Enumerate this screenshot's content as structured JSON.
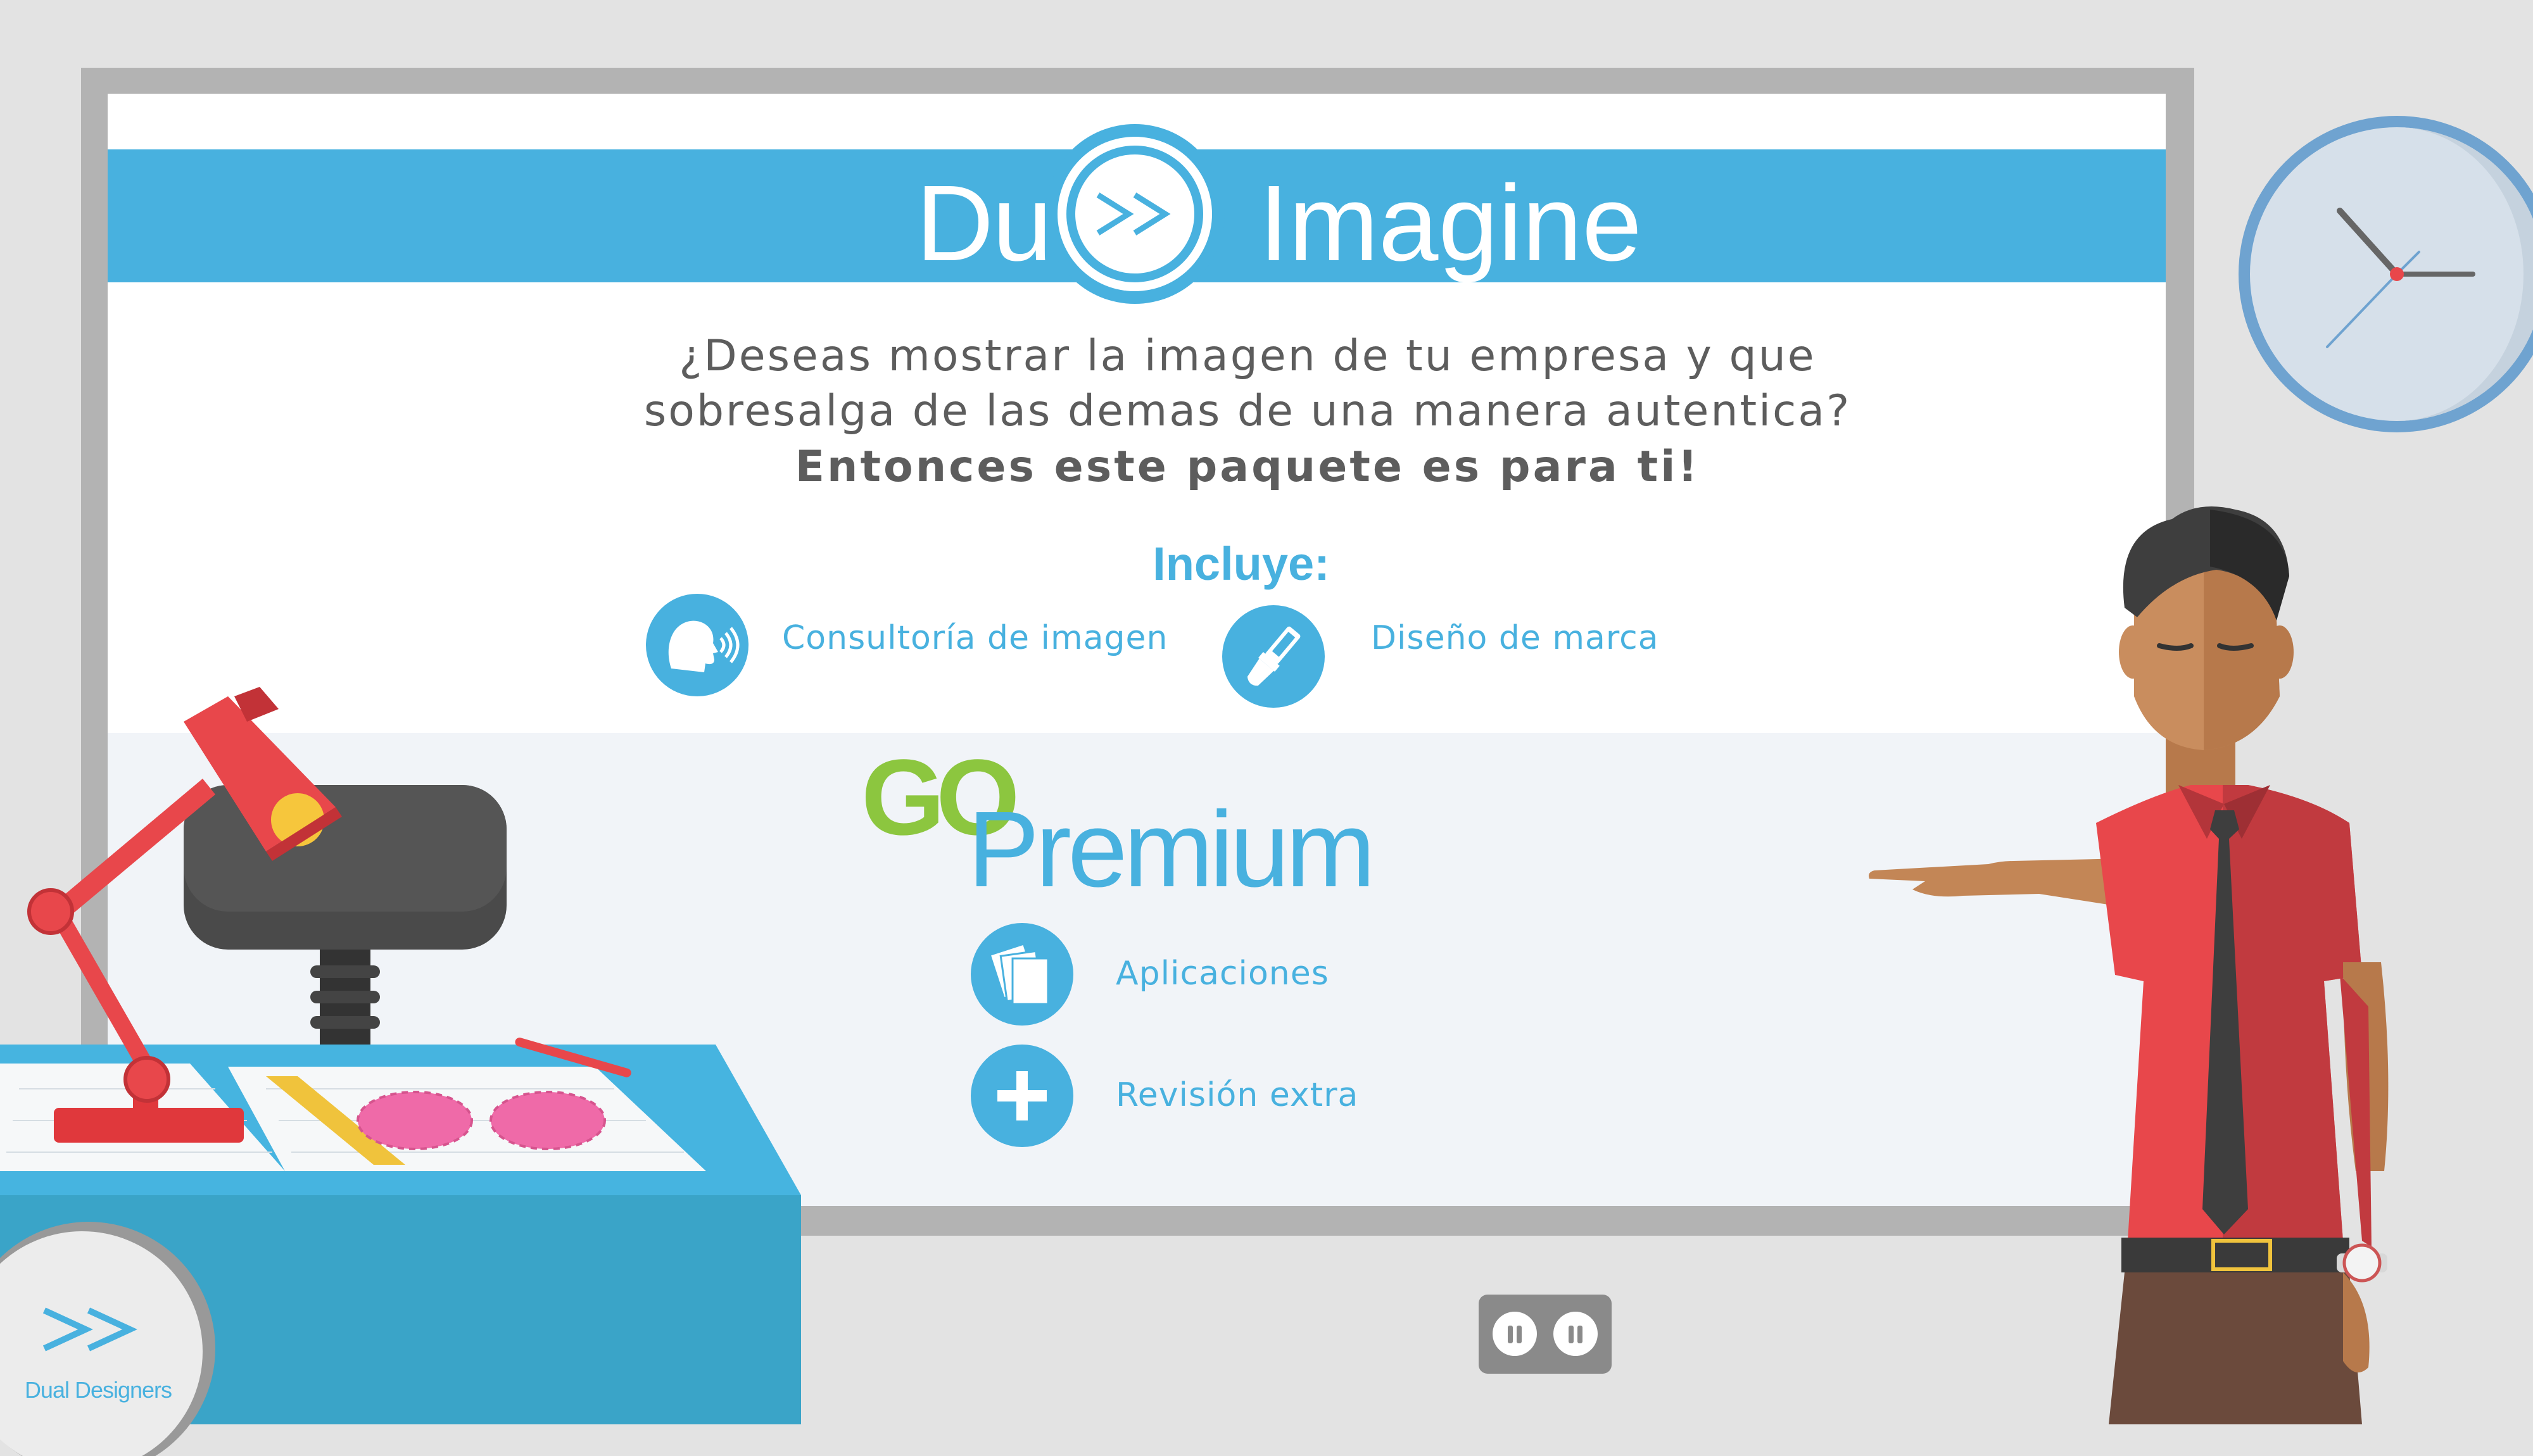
{
  "header": {
    "brand_left": "Dual",
    "brand_right": "Imagine",
    "badge_icon": "double-chevron-right-icon"
  },
  "intro": {
    "line1": "¿Deseas mostrar la imagen de tu empresa y que",
    "line2": "sobresalga de las demas de una manera autentica?",
    "line3": "Entonces este paquete es para ti!"
  },
  "includes": {
    "title": "Incluye:",
    "items": [
      {
        "label": "Consultoría de imagen",
        "icon": "speaking-head-icon"
      },
      {
        "label": "Diseño de marca",
        "icon": "paintbrush-icon"
      }
    ]
  },
  "premium": {
    "logo_go": "GO",
    "logo_premium": "Premium",
    "items": [
      {
        "label": "Aplicaciones",
        "icon": "cards-icon"
      },
      {
        "label": "Revisión extra",
        "icon": "plus-icon"
      }
    ]
  },
  "corner_logo": {
    "text": "Dual Designers",
    "icon": "double-chevron-right-icon"
  },
  "controls": {
    "pause_icon": "pause-icon"
  },
  "colors": {
    "accent": "#48b1df",
    "go_green": "#8cc63f",
    "shirt_red": "#e8474b",
    "background": "#e3e3e3"
  }
}
